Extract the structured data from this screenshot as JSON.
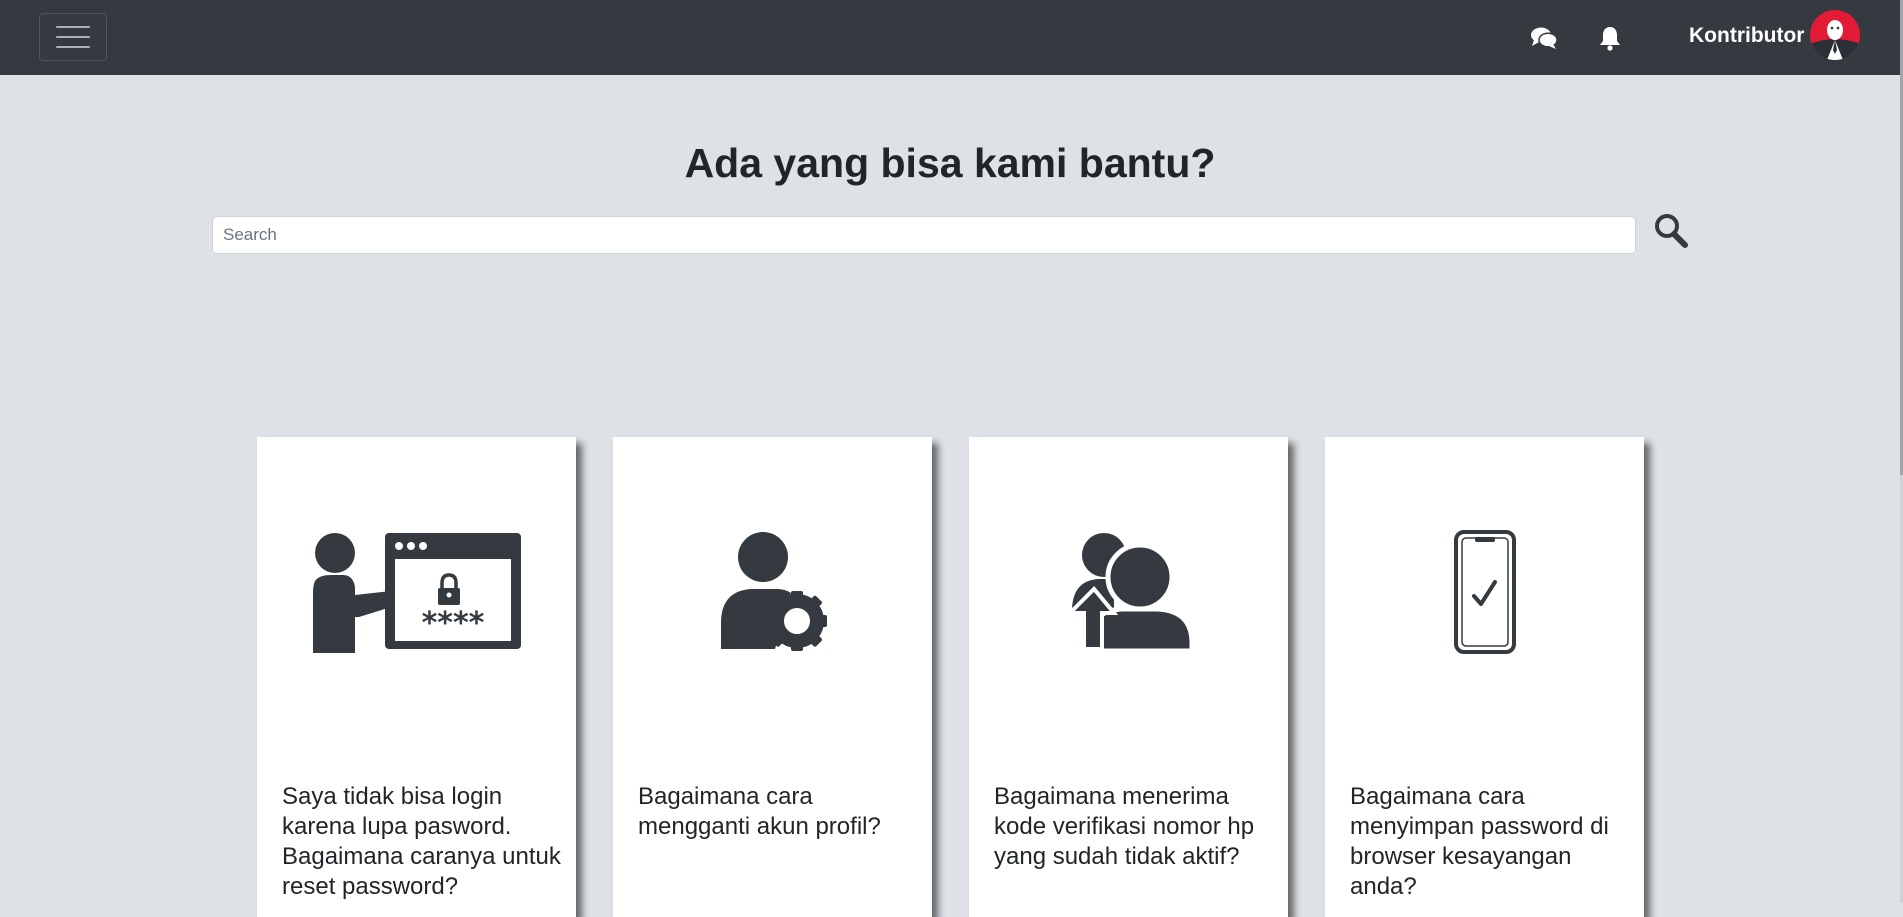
{
  "navbar": {
    "menu_icon": "hamburger-icon",
    "chat_icon": "chat-bubbles-icon",
    "bell_icon": "bell-icon",
    "user_name": "Kontributor",
    "avatar_icon": "avatar"
  },
  "hero": {
    "title": "Ada yang bisa kami bantu?",
    "search": {
      "placeholder": "Search",
      "value": "",
      "icon": "search-icon"
    }
  },
  "cards": [
    {
      "icon": "password-reset-icon",
      "question": "Saya tidak bisa login karena lupa pasword. Bagaimana caranya untuk reset password?"
    },
    {
      "icon": "user-settings-icon",
      "question": "Bagaimana cara mengganti akun profil?"
    },
    {
      "icon": "user-switch-icon",
      "question": "Bagaimana menerima kode verifikasi nomor hp yang sudah tidak aktif?"
    },
    {
      "icon": "phone-check-icon",
      "question": "Bagaimana cara menyimpan password di browser kesayangan anda?"
    }
  ],
  "colors": {
    "navbar": "#343a40",
    "background": "#dee2e6",
    "icon": "#343a40",
    "avatar_accent": "#e31b35"
  }
}
